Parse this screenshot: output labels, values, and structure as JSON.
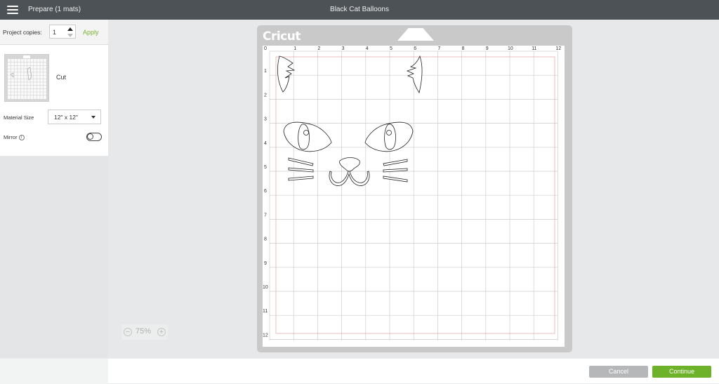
{
  "header": {
    "menu_icon": "hamburger-menu-icon",
    "mode_label": "Prepare (1 mats)",
    "project_title": "Black Cat Balloons"
  },
  "sidebar": {
    "copies_label": "Project copies:",
    "copies_value": "1",
    "apply_label": "Apply",
    "mat_label": "Cut",
    "material_size_label": "Material Size",
    "material_size_value": "12\" x 12\"",
    "mirror_label": "Mirror",
    "mirror_info_icon": "i",
    "mirror_on": false
  },
  "zoom": {
    "minus": "−",
    "value": "75%",
    "plus": "+"
  },
  "mat": {
    "brand": "Cricut",
    "ruler_top": [
      "0",
      "1",
      "2",
      "3",
      "4",
      "5",
      "6",
      "7",
      "8",
      "9",
      "10",
      "11",
      "12"
    ],
    "ruler_left": [
      "1",
      "2",
      "3",
      "4",
      "5",
      "6",
      "7",
      "8",
      "9",
      "10",
      "11",
      "12"
    ],
    "grid_color": "#cccccc",
    "cut_line_color": "#e8a0a0"
  },
  "footer": {
    "cancel_label": "Cancel",
    "continue_label": "Continue"
  },
  "colors": {
    "topbar": "#4d5256",
    "accent_green": "#6eb22a",
    "cancel_gray": "#b5b7b9"
  }
}
